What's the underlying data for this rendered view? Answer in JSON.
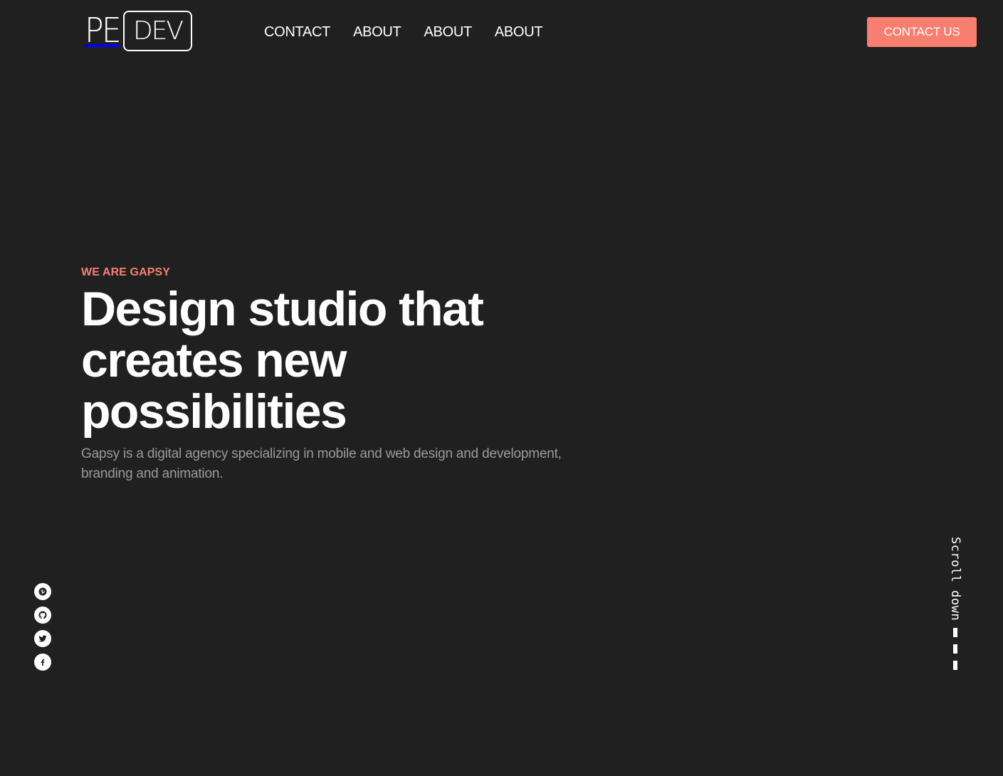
{
  "logo": {
    "left": "PE",
    "right": "DEV"
  },
  "nav": {
    "items": [
      {
        "label": "CONTACT"
      },
      {
        "label": "ABOUT"
      },
      {
        "label": "ABOUT"
      },
      {
        "label": "ABOUT"
      }
    ]
  },
  "header": {
    "cta_label": "CONTACT US"
  },
  "hero": {
    "eyebrow": "WE ARE GAPSY",
    "title": "Design studio that creates new possibilities",
    "description": "Gapsy is a digital agency specializing in mobile and web design and development, branding and animation."
  },
  "social": {
    "icons": [
      "pinterest-icon",
      "github-icon",
      "twitter-icon",
      "facebook-icon"
    ]
  },
  "scroll": {
    "label": "Scroll down"
  },
  "colors": {
    "background": "#202020",
    "accent": "#f87f70",
    "text": "#ffffff",
    "muted": "#9a9a9a"
  }
}
